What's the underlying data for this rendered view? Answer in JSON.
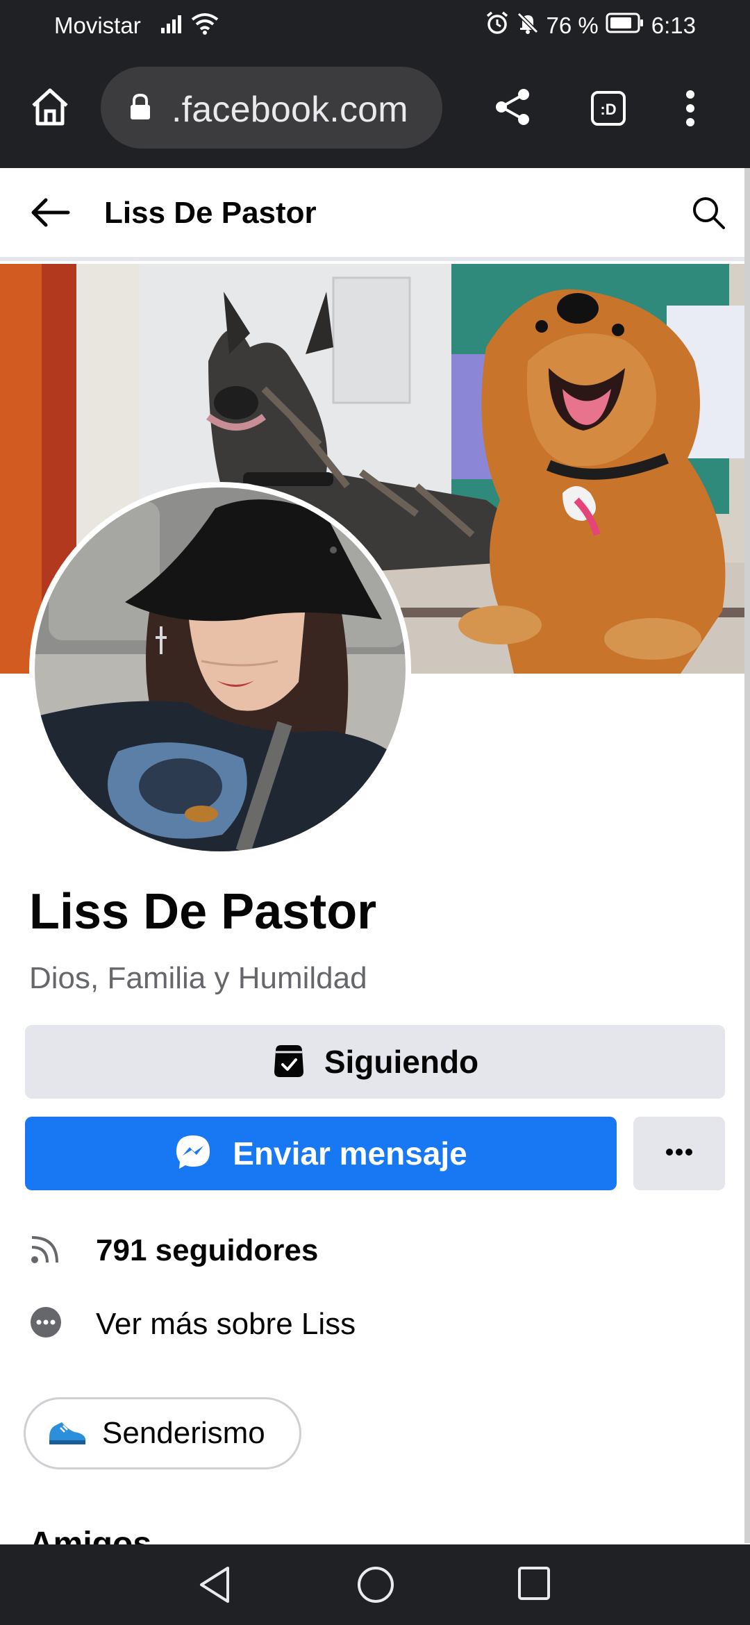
{
  "status_bar": {
    "carrier": "Movistar",
    "battery": "76 %",
    "time": "6:13"
  },
  "browser": {
    "url": ".facebook.com"
  },
  "header": {
    "title": "Liss De Pastor"
  },
  "profile": {
    "name": "Liss De Pastor",
    "bio": "Dios, Familia y Humildad",
    "following_label": "Siguiendo",
    "message_label": "Enviar mensaje",
    "followers": "791 seguidores",
    "about": "Ver más sobre Liss",
    "interest": "Senderismo",
    "friends_heading": "Amigos"
  },
  "colors": {
    "primary_blue": "#1877f2",
    "secondary_gray": "#e4e6eb",
    "text_secondary": "#65676b",
    "system_bar": "#202124"
  },
  "icons": {
    "home": "home-icon",
    "lock": "lock-icon",
    "share": "share-icon",
    "tabs": "tab-switcher-icon",
    "menu": "more-vert-icon",
    "back": "arrow-left-icon",
    "search": "search-icon",
    "following": "following-check-icon",
    "messenger": "messenger-icon",
    "more": "more-horiz-icon",
    "followers": "rss-icon",
    "about": "more-circle-icon",
    "interest": "sneaker-icon"
  }
}
